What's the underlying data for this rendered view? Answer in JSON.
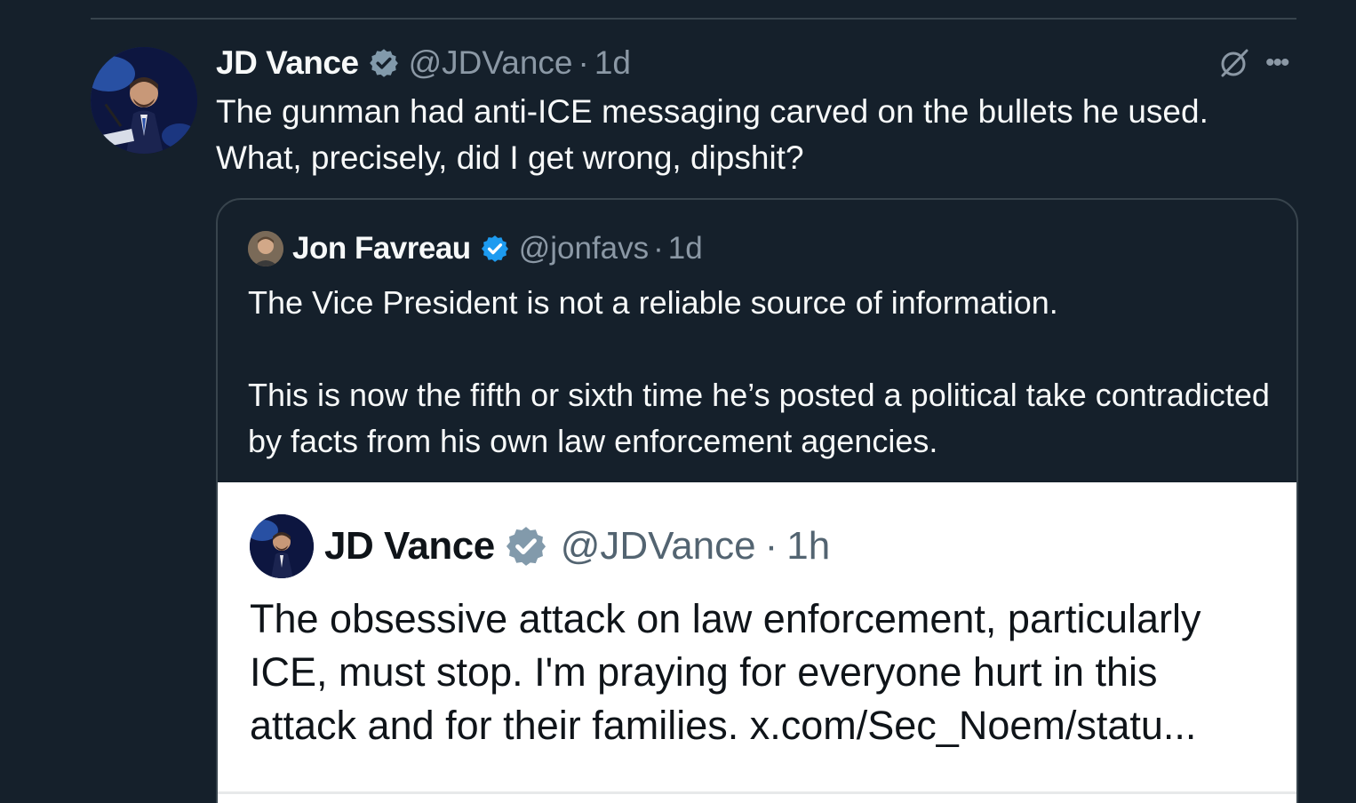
{
  "tweet": {
    "author_name": "JD Vance",
    "handle": "@JDVance",
    "separator": "·",
    "time": "1d",
    "text": "The gunman had anti-ICE messaging carved on the bullets he used.\nWhat, precisely, did I get wrong, dipshit?",
    "icons": {
      "verified": "verified-badge-icon",
      "grok": "grok-icon",
      "more": "more-options-icon"
    }
  },
  "quote": {
    "author_name": "Jon Favreau",
    "handle": "@jonfavs",
    "separator": "·",
    "time": "1d",
    "paragraphs": [
      "The Vice President is not a reliable source of information.",
      "This is now the fifth or sixth time he’s posted a political take contradicted by facts from his own law enforcement agencies."
    ]
  },
  "embedded_screenshot": {
    "author_name": "JD Vance",
    "handle": "@JDVance",
    "separator": "·",
    "time": "1h",
    "text": "The obsessive attack on law enforcement, particularly ICE, must stop. I'm praying for everyone hurt in this attack and for their families. x.com/Sec_Noem/statu..."
  },
  "colors": {
    "background": "#15202b",
    "border": "#38444d",
    "verified_blue": "#1d9bf0",
    "verified_gray": "#829aab",
    "secondary_text": "#8b98a5"
  }
}
